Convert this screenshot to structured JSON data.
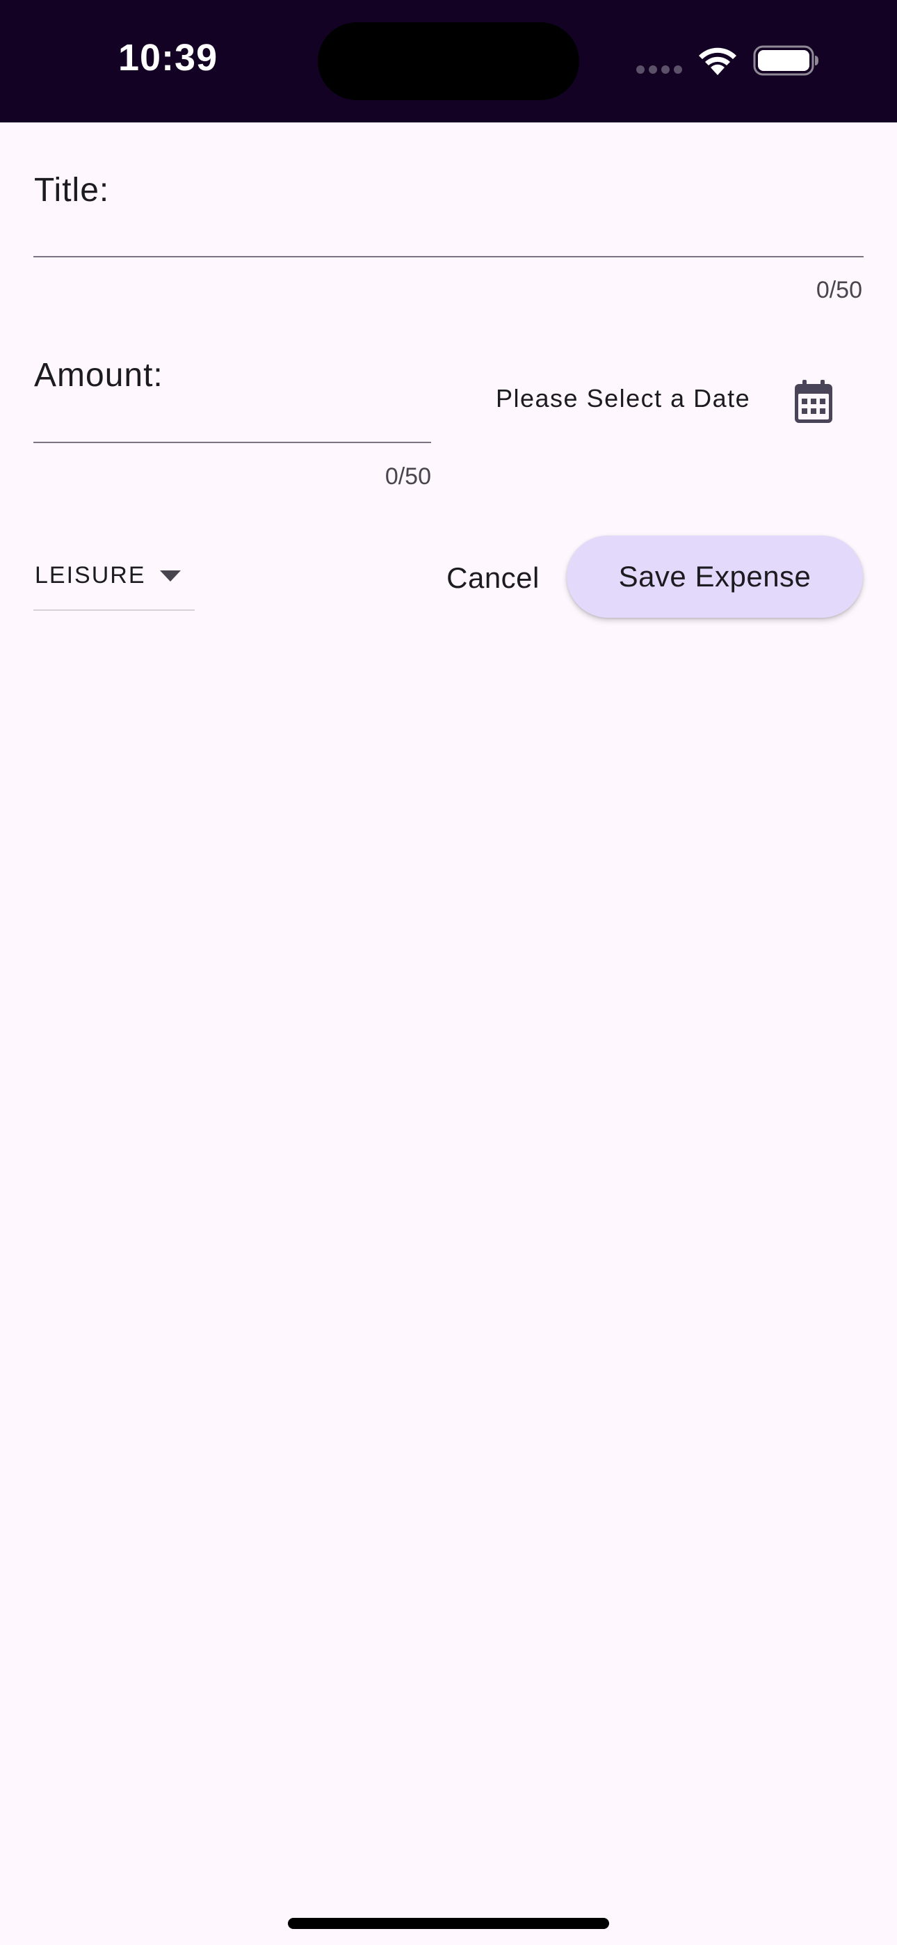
{
  "status_bar": {
    "time": "10:39",
    "background": "#140225"
  },
  "form": {
    "title_label": "Title:",
    "title_value": "",
    "title_counter": "0/50",
    "amount_label": "Amount:",
    "amount_value": "",
    "amount_counter": "0/50",
    "date_label": "Please Select a Date",
    "date_icon": "calendar-icon"
  },
  "actions": {
    "category_selected": "LEISURE",
    "cancel_label": "Cancel",
    "save_label": "Save Expense",
    "save_color": "#e3d9fb"
  }
}
